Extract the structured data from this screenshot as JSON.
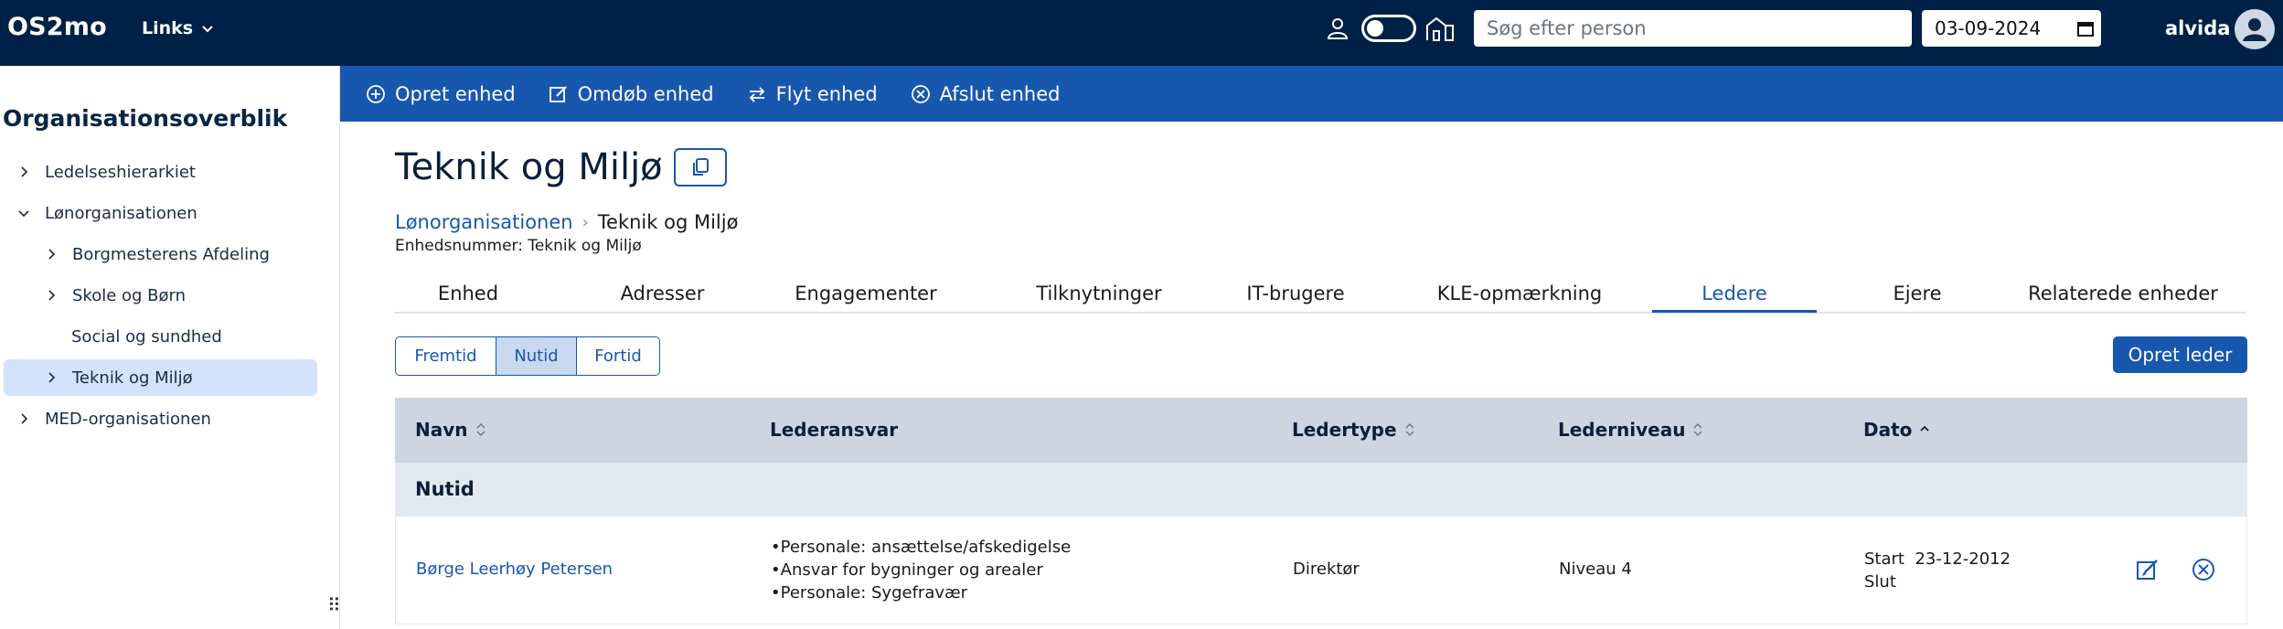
{
  "header": {
    "logo": "OS2mo",
    "links_label": "Links",
    "search_placeholder": "Søg efter person",
    "date_value": "03-09-2024",
    "user_name": "alvida"
  },
  "sidebar": {
    "title": "Organisationsoverblik",
    "items": [
      {
        "label": "Ledelseshierarkiet",
        "chevron": "right"
      },
      {
        "label": "Lønorganisationen",
        "chevron": "down"
      },
      {
        "label": "Borgmesterens Afdeling",
        "chevron": "right"
      },
      {
        "label": "Skole og Børn",
        "chevron": "right"
      },
      {
        "label": "Social og sundhed",
        "chevron": "none"
      },
      {
        "label": "Teknik og Miljø",
        "chevron": "right",
        "selected": true
      },
      {
        "label": "MED-organisationen",
        "chevron": "right"
      }
    ]
  },
  "actions": {
    "create": "Opret enhed",
    "rename": "Omdøb enhed",
    "move": "Flyt enhed",
    "terminate": "Afslut enhed"
  },
  "page": {
    "title": "Teknik og Miljø",
    "breadcrumb": {
      "parent": "Lønorganisationen",
      "current": "Teknik og Miljø"
    },
    "unit_number": "Enhedsnummer: Teknik og Miljø"
  },
  "tabs": [
    {
      "label": "Enhed"
    },
    {
      "label": "Adresser"
    },
    {
      "label": "Engagementer"
    },
    {
      "label": "Tilknytninger"
    },
    {
      "label": "IT-brugere"
    },
    {
      "label": "KLE-opmærkning"
    },
    {
      "label": "Ledere",
      "active": true
    },
    {
      "label": "Ejere"
    },
    {
      "label": "Relaterede enheder"
    }
  ],
  "time_filter": {
    "options": [
      "Fremtid",
      "Nutid",
      "Fortid"
    ],
    "selected": "Nutid"
  },
  "create_manager_button": "Opret leder",
  "table": {
    "columns": [
      {
        "label": "Navn",
        "sort": "both"
      },
      {
        "label": "Lederansvar",
        "sort": "none"
      },
      {
        "label": "Ledertype",
        "sort": "both"
      },
      {
        "label": "Lederniveau",
        "sort": "both"
      },
      {
        "label": "Dato",
        "sort": "up"
      }
    ],
    "group_label": "Nutid",
    "rows": [
      {
        "name": "Børge Leerhøy Petersen",
        "responsibilities": [
          "Personale: ansættelse/afskedigelse",
          "Ansvar for bygninger og arealer",
          "Personale: Sygefravær"
        ],
        "type": "Direktør",
        "level": "Niveau 4",
        "start_label": "Start",
        "start_date": "23-12-2012",
        "end_label": "Slut",
        "end_date": ""
      }
    ]
  },
  "colors": {
    "header_bg": "#002147",
    "accent": "#1857ae",
    "selected_bg": "#d3e3fb",
    "table_header_bg": "#cdd5e0",
    "group_row_bg": "#e4e9f0"
  }
}
